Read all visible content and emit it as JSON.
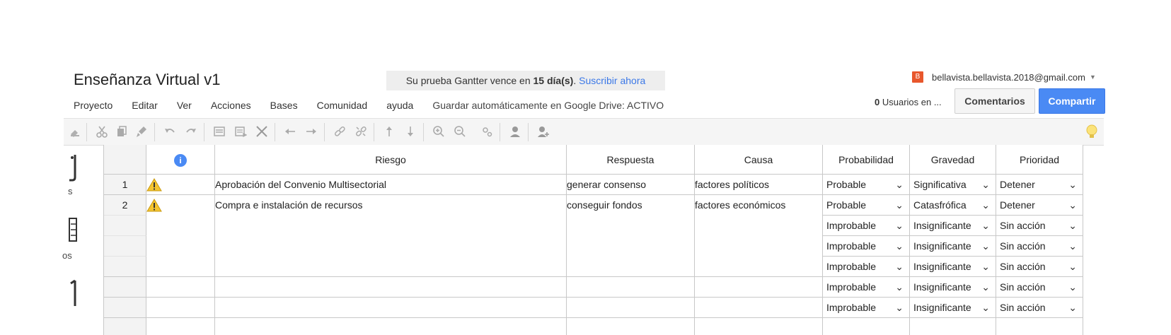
{
  "document": {
    "title": "Enseñanza Virtual v1"
  },
  "trial": {
    "text_before": "Su prueba Gantter vence en ",
    "days": "15 día(s)",
    "text_after": ".",
    "link": "Suscribir ahora"
  },
  "account": {
    "badge": "B",
    "email": "bellavista.bellavista.2018@gmail.com"
  },
  "menu": [
    "Proyecto",
    "Editar",
    "Ver",
    "Acciones",
    "Bases",
    "Comunidad",
    "ayuda"
  ],
  "autosave": "Guardar automáticamente en Google Drive: ACTIVO",
  "users": {
    "count": "0",
    "label": " Usuarios en ..."
  },
  "buttons": {
    "comments": "Comentarios",
    "share": "Compartir"
  },
  "colors": {
    "share_button": "#4a8af4",
    "warning": "#f4c430",
    "badge": "#e8572c",
    "info": "#4a8af4"
  },
  "left_strip": {
    "label1": "s",
    "label2": "os"
  },
  "table": {
    "headers": {
      "info": "i",
      "riesgo": "Riesgo",
      "respuesta": "Respuesta",
      "causa": "Causa",
      "probabilidad": "Probabilidad",
      "gravedad": "Gravedad",
      "prioridad": "Prioridad"
    },
    "rows": [
      {
        "num": "1",
        "riesgo": "Aprobación del Convenio Multisectorial",
        "respuesta": "generar consenso",
        "causa": "factores políticos"
      },
      {
        "num": "2",
        "riesgo": "Compra e instalación de recursos",
        "respuesta": "conseguir fondos",
        "causa": "factores económicos"
      }
    ],
    "selects": [
      {
        "probabilidad": "Probable",
        "gravedad": "Significativa",
        "prioridad": "Detener"
      },
      {
        "probabilidad": "Probable",
        "gravedad": "Catasfrófica",
        "prioridad": "Detener"
      },
      {
        "probabilidad": "Improbable",
        "gravedad": "Insignificante",
        "prioridad": "Sin acción"
      },
      {
        "probabilidad": "Improbable",
        "gravedad": "Insignificante",
        "prioridad": "Sin acción"
      },
      {
        "probabilidad": "Improbable",
        "gravedad": "Insignificante",
        "prioridad": "Sin acción"
      },
      {
        "probabilidad": "Improbable",
        "gravedad": "Insignificante",
        "prioridad": "Sin acción"
      },
      {
        "probabilidad": "Improbable",
        "gravedad": "Insignificante",
        "prioridad": "Sin acción"
      }
    ]
  },
  "toolbar_icons": [
    "paint-icon",
    "cut-icon",
    "copy-icon",
    "format-brush-icon",
    "undo-icon",
    "redo-icon",
    "insert-row-icon",
    "insert-task-icon",
    "delete-icon",
    "outdent-icon",
    "indent-icon",
    "link-icon",
    "unlink-icon",
    "move-up-icon",
    "move-down-icon",
    "zoom-in-icon",
    "zoom-out-icon",
    "settings-icon",
    "user-icon",
    "user-add-icon",
    "lightbulb-icon"
  ]
}
